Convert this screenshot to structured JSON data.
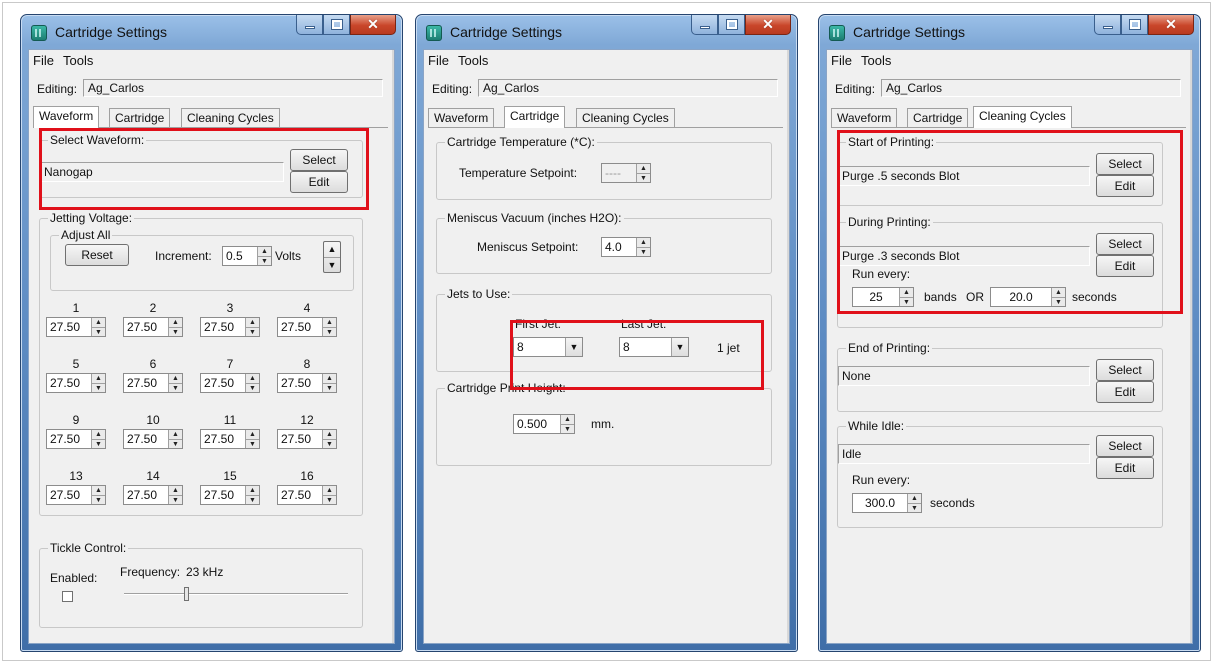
{
  "colors": {
    "highlight": "#e0101a",
    "titlebar": "#7fa8d6",
    "client_bg": "#f0f0f0"
  },
  "windows": [
    {
      "title": "Cartridge Settings",
      "menu": [
        "File",
        "Tools"
      ],
      "editing_label": "Editing:",
      "editing_value": "Ag_Carlos",
      "tabs": [
        "Waveform",
        "Cartridge",
        "Cleaning Cycles"
      ],
      "active_tab": "Waveform",
      "select_waveform": {
        "title": "Select Waveform:",
        "value": "Nanogap",
        "select_label": "Select",
        "edit_label": "Edit"
      },
      "jetting": {
        "title": "Jetting Voltage:",
        "adjust_all": "Adjust All",
        "reset_label": "Reset",
        "increment_label": "Increment:",
        "increment_value": "0.5",
        "volts_label": "Volts",
        "jets": [
          {
            "n": "1",
            "v": "27.50"
          },
          {
            "n": "2",
            "v": "27.50"
          },
          {
            "n": "3",
            "v": "27.50"
          },
          {
            "n": "4",
            "v": "27.50"
          },
          {
            "n": "5",
            "v": "27.50"
          },
          {
            "n": "6",
            "v": "27.50"
          },
          {
            "n": "7",
            "v": "27.50"
          },
          {
            "n": "8",
            "v": "27.50"
          },
          {
            "n": "9",
            "v": "27.50"
          },
          {
            "n": "10",
            "v": "27.50"
          },
          {
            "n": "11",
            "v": "27.50"
          },
          {
            "n": "12",
            "v": "27.50"
          },
          {
            "n": "13",
            "v": "27.50"
          },
          {
            "n": "14",
            "v": "27.50"
          },
          {
            "n": "15",
            "v": "27.50"
          },
          {
            "n": "16",
            "v": "27.50"
          }
        ]
      },
      "tickle": {
        "title": "Tickle Control:",
        "enabled_label": "Enabled:",
        "frequency_label": "Frequency:",
        "frequency_value": "23 kHz"
      }
    },
    {
      "title": "Cartridge Settings",
      "menu": [
        "File",
        "Tools"
      ],
      "editing_label": "Editing:",
      "editing_value": "Ag_Carlos",
      "tabs": [
        "Waveform",
        "Cartridge",
        "Cleaning Cycles"
      ],
      "active_tab": "Cartridge",
      "temperature": {
        "title": "Cartridge Temperature (*C):",
        "setpoint_label": "Temperature Setpoint:",
        "setpoint_value": "----"
      },
      "meniscus": {
        "title": "Meniscus Vacuum (inches H2O):",
        "setpoint_label": "Meniscus Setpoint:",
        "setpoint_value": "4.0"
      },
      "jets_to_use": {
        "title": "Jets to Use:",
        "first_label": "First Jet:",
        "first_value": "8",
        "last_label": "Last Jet:",
        "last_value": "8",
        "count_label": "1 jet"
      },
      "print_height": {
        "title": "Cartridge Print Height:",
        "value": "0.500",
        "unit": "mm."
      }
    },
    {
      "title": "Cartridge Settings",
      "menu": [
        "File",
        "Tools"
      ],
      "editing_label": "Editing:",
      "editing_value": "Ag_Carlos",
      "tabs": [
        "Waveform",
        "Cartridge",
        "Cleaning Cycles"
      ],
      "active_tab": "Cleaning Cycles",
      "start_printing": {
        "title": "Start of Printing:",
        "value": "Purge .5 seconds Blot",
        "select_label": "Select",
        "edit_label": "Edit"
      },
      "during_printing": {
        "title": "During Printing:",
        "value": "Purge .3 seconds Blot",
        "select_label": "Select",
        "edit_label": "Edit",
        "run_every_label": "Run every:",
        "bands_value": "25",
        "bands_label": "bands",
        "or_label": "OR",
        "seconds_value": "20.0",
        "seconds_label": "seconds"
      },
      "end_printing": {
        "title": "End of Printing:",
        "value": "None",
        "select_label": "Select",
        "edit_label": "Edit"
      },
      "while_idle": {
        "title": "While Idle:",
        "value": "Idle",
        "select_label": "Select",
        "edit_label": "Edit",
        "run_every_label": "Run every:",
        "seconds_value": "300.0",
        "seconds_label": "seconds"
      }
    }
  ]
}
